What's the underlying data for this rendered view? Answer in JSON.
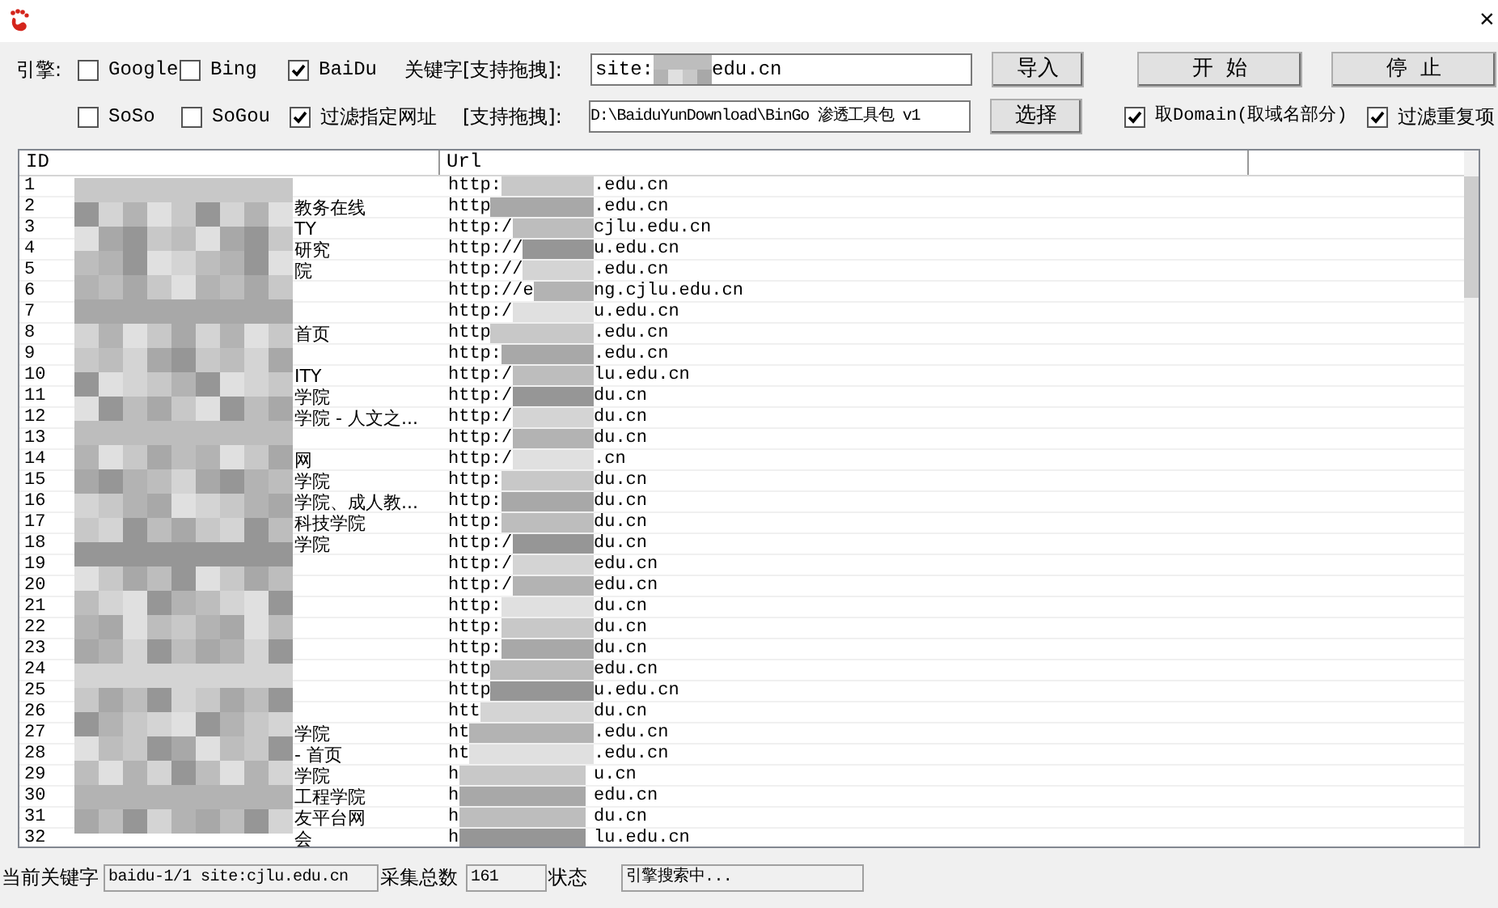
{
  "window": {
    "close_glyph": "×"
  },
  "engine_label": "引擎:",
  "engines": [
    {
      "label": "Google",
      "checked": false
    },
    {
      "label": "Bing",
      "checked": false
    },
    {
      "label": "BaiDu",
      "checked": true
    },
    {
      "label": "SoSo",
      "checked": false
    },
    {
      "label": "SoGou",
      "checked": false
    }
  ],
  "filter_url": {
    "label": "过滤指定网址",
    "checked": true
  },
  "keyword": {
    "label": "关键字[支持拖拽]:",
    "value_start": "site:",
    "value_end": "edu.cn",
    "button": "导入"
  },
  "path": {
    "label": "[支持拖拽]:",
    "value": "D:\\BaiduYunDownload\\BinGo 渗透工具包 v1",
    "button": "选择"
  },
  "start_button": "开  始",
  "stop_button": "停  止",
  "take_domain": {
    "label": "取Domain(取域名部分)",
    "checked": true
  },
  "dedupe": {
    "label": "过滤重复项",
    "checked": true
  },
  "table": {
    "columns": [
      "ID",
      "Url"
    ],
    "rows": [
      {
        "id": "1",
        "title": "",
        "url_start": "http:",
        "url_end": ".edu.cn"
      },
      {
        "id": "2",
        "title": "教务在线",
        "url_start": "http",
        "url_end": ".edu.cn"
      },
      {
        "id": "3",
        "title": "TY",
        "url_start": "http:/",
        "url_end": "cjlu.edu.cn"
      },
      {
        "id": "4",
        "title": "研究",
        "url_start": "http://",
        "url_end": "u.edu.cn"
      },
      {
        "id": "5",
        "title": "院",
        "url_start": "http://",
        "url_end": ".edu.cn"
      },
      {
        "id": "6",
        "title": "",
        "url_start": "http://e",
        "url_end": "ng.cjlu.edu.cn"
      },
      {
        "id": "7",
        "title": "",
        "url_start": "http:/",
        "url_end": "u.edu.cn"
      },
      {
        "id": "8",
        "title": "首页",
        "url_start": "http",
        "url_end": ".edu.cn"
      },
      {
        "id": "9",
        "title": "",
        "url_start": "http:",
        "url_end": ".edu.cn"
      },
      {
        "id": "10",
        "title": "ITY",
        "url_start": "http:/",
        "url_end": "lu.edu.cn"
      },
      {
        "id": "11",
        "title": "学院",
        "url_start": "http:/",
        "url_end": "du.cn"
      },
      {
        "id": "12",
        "title": "学院 - 人文之...",
        "url_start": "http:/",
        "url_end": "du.cn"
      },
      {
        "id": "13",
        "title": "",
        "url_start": "http:/",
        "url_end": "du.cn"
      },
      {
        "id": "14",
        "title": "网",
        "url_start": "http:/",
        "url_end": ".cn"
      },
      {
        "id": "15",
        "title": "学院",
        "url_start": "http:",
        "url_end": "du.cn"
      },
      {
        "id": "16",
        "title": "学院、成人教...",
        "url_start": "http:",
        "url_end": "du.cn"
      },
      {
        "id": "17",
        "title": "科技学院",
        "url_start": "http:",
        "url_end": "du.cn"
      },
      {
        "id": "18",
        "title": "学院",
        "url_start": "http:/",
        "url_end": "du.cn"
      },
      {
        "id": "19",
        "title": "",
        "url_start": "http:/",
        "url_end": "edu.cn"
      },
      {
        "id": "20",
        "title": "",
        "url_start": "http:/",
        "url_end": "edu.cn"
      },
      {
        "id": "21",
        "title": "",
        "url_start": "http:",
        "url_end": "du.cn"
      },
      {
        "id": "22",
        "title": "",
        "url_start": "http:",
        "url_end": "du.cn"
      },
      {
        "id": "23",
        "title": "",
        "url_start": "http:",
        "url_end": "du.cn"
      },
      {
        "id": "24",
        "title": "",
        "url_start": "http",
        "url_end": "edu.cn"
      },
      {
        "id": "25",
        "title": "",
        "url_start": "http",
        "url_end": "u.edu.cn"
      },
      {
        "id": "26",
        "title": "",
        "url_start": "htt",
        "url_end": "du.cn"
      },
      {
        "id": "27",
        "title": "学院",
        "url_start": "ht",
        "url_end": ".edu.cn"
      },
      {
        "id": "28",
        "title": "- 首页",
        "url_start": "ht",
        "url_end": ".edu.cn"
      },
      {
        "id": "29",
        "title": "学院",
        "url_start": "h",
        "url_end": "u.cn"
      },
      {
        "id": "30",
        "title": "工程学院",
        "url_start": "h",
        "url_end": "edu.cn"
      },
      {
        "id": "31",
        "title": "友平台网",
        "url_start": "h",
        "url_end": "du.cn"
      },
      {
        "id": "32",
        "title": "会",
        "url_start": "h",
        "url_end": "lu.edu.cn"
      }
    ]
  },
  "status_bar": [
    {
      "kind": "label",
      "text": "当前关键字"
    },
    {
      "kind": "value",
      "text": "baidu-1/1 site:cjlu.edu.cn"
    },
    {
      "kind": "label",
      "text": "采集总数"
    },
    {
      "kind": "value",
      "text": "161"
    },
    {
      "kind": "label",
      "text": "状态"
    },
    {
      "kind": "value",
      "text": "引擎搜索中..."
    }
  ]
}
